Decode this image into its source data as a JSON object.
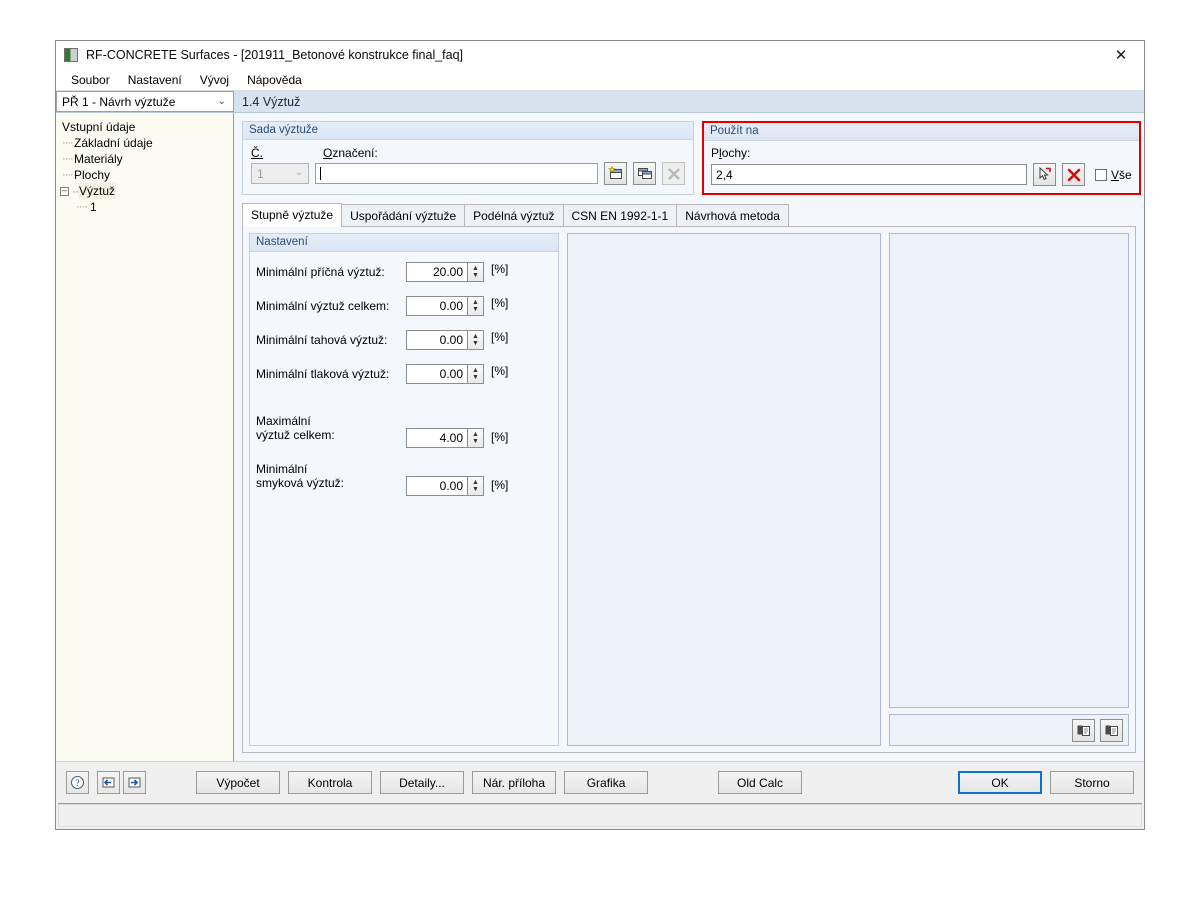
{
  "window": {
    "title": "RF-CONCRETE Surfaces - [201911_Betonové konstrukce final_faq]",
    "close_label": "✕",
    "app_icon": "application-icon"
  },
  "menu": {
    "items": [
      {
        "label": "Soubor"
      },
      {
        "label": "Nastavení"
      },
      {
        "label": "Vývoj"
      },
      {
        "label": "Nápověda"
      }
    ]
  },
  "header": {
    "nav_select_value": "PŘ 1 - Návrh výztuže",
    "page_title": "1.4 Výztuž"
  },
  "sidebar": {
    "root": "Vstupní údaje",
    "children": [
      {
        "label": "Základní údaje"
      },
      {
        "label": "Materiály"
      },
      {
        "label": "Plochy"
      }
    ],
    "expandable": {
      "label": "Výztuž",
      "child": "1"
    }
  },
  "sada": {
    "group_title": "Sada výztuže",
    "number_label": "Č.",
    "number_value": "1",
    "designation_label": "Označení:",
    "designation_value": "",
    "buttons": [
      {
        "name": "new-set-button"
      },
      {
        "name": "copy-set-button"
      },
      {
        "name": "delete-set-button"
      }
    ]
  },
  "pouzit": {
    "group_title": "Použít na",
    "surfaces_label": "Plochy:",
    "surfaces_value": "2,4",
    "all_checkbox_label": "Vše",
    "all_checked": false,
    "highlight_color": "#e00000"
  },
  "tabs": [
    {
      "label": "Stupně výztuže",
      "active": true
    },
    {
      "label": "Uspořádání výztuže",
      "active": false
    },
    {
      "label": "Podélná výztuž",
      "active": false
    },
    {
      "label": "CSN EN 1992-1-1",
      "active": false
    },
    {
      "label": "Návrhová metoda",
      "active": false
    }
  ],
  "settings": {
    "group_title": "Nastavení",
    "unit": "[%]",
    "rows": [
      {
        "label": "Minimální příčná výztuž:",
        "value": "20.00"
      },
      {
        "label": "Minimální výztuž celkem:",
        "value": "0.00"
      },
      {
        "label": "Minimální tahová výztuž:",
        "value": "0.00"
      },
      {
        "label": "Minimální tlaková výztuž:",
        "value": "0.00"
      },
      {
        "label": "Maximální\nvýztuž celkem:",
        "value": "4.00"
      },
      {
        "label": "Minimální\nsmyková výztuž:",
        "value": "0.00"
      }
    ]
  },
  "footer": {
    "help_icon": "help-icon",
    "nav_prev_icon": "previous-icon",
    "nav_next_icon": "next-icon",
    "buttons": [
      {
        "label": "Výpočet",
        "name": "calculate-button"
      },
      {
        "label": "Kontrola",
        "name": "check-button"
      },
      {
        "label": "Detaily...",
        "name": "details-button"
      },
      {
        "label": "Nár. příloha",
        "name": "national-annex-button"
      },
      {
        "label": "Grafika",
        "name": "graphics-button"
      },
      {
        "label": "Old Calc",
        "name": "old-calc-button"
      }
    ],
    "ok_label": "OK",
    "cancel_label": "Storno"
  }
}
